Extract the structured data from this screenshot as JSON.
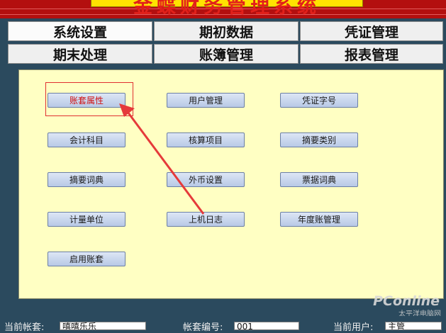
{
  "title": "金蝶财务管理系统",
  "tabs": [
    {
      "label": "系统设置"
    },
    {
      "label": "期初数据"
    },
    {
      "label": "凭证管理"
    },
    {
      "label": "期末处理"
    },
    {
      "label": "账簿管理"
    },
    {
      "label": "报表管理"
    }
  ],
  "buttons": {
    "account_set_props": "账套属性",
    "user_management": "用户管理",
    "voucher_words": "凭证字号",
    "accounting_subjects": "会计科目",
    "accounting_items": "核算项目",
    "summary_categories": "摘要类别",
    "summary_dictionary": "摘要词典",
    "currency_settings": "外币设置",
    "bill_dictionary": "票据词典",
    "measurement_units": "计量单位",
    "login_log": "上机日志",
    "annual_account_mgmt": "年度账管理",
    "enable_account_set": "启用账套"
  },
  "status": {
    "current_set_label": "当前帐套:",
    "current_set_value": "嘻嘻乐乐",
    "set_number_label": "帐套编号:",
    "set_number_value": "001",
    "current_user_label": "当前用户:",
    "current_user_value": "主管"
  },
  "watermark": {
    "logo": "PConline",
    "sub": "太平洋电脑网"
  },
  "colors": {
    "title_bar": "#b30f0f",
    "title_box": "#ffe300",
    "panel_bg": "#ffffc3",
    "highlight": "#e03030"
  }
}
